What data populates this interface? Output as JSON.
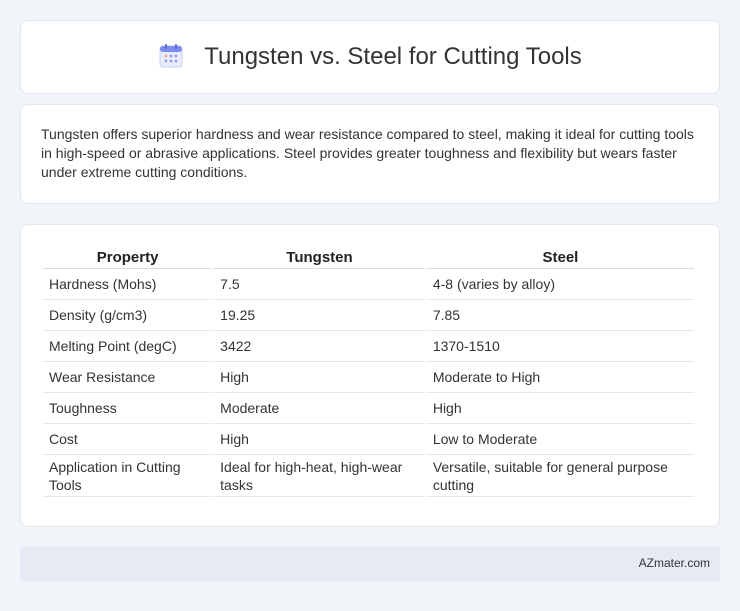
{
  "header": {
    "title": "Tungsten vs. Steel for Cutting Tools",
    "icon": "calendar-icon"
  },
  "summary": {
    "text": "Tungsten offers superior hardness and wear resistance compared to steel, making it ideal for cutting tools in high-speed or abrasive applications. Steel provides greater toughness and flexibility but wears faster under extreme cutting conditions."
  },
  "table": {
    "headers": [
      "Property",
      "Tungsten",
      "Steel"
    ],
    "rows": [
      [
        "Hardness (Mohs)",
        "7.5",
        "4-8 (varies by alloy)"
      ],
      [
        "Density (g/cm3)",
        "19.25",
        "7.85"
      ],
      [
        "Melting Point (degC)",
        "3422",
        "1370-1510"
      ],
      [
        "Wear Resistance",
        "High",
        "Moderate to High"
      ],
      [
        "Toughness",
        "Moderate",
        "High"
      ],
      [
        "Cost",
        "High",
        "Low to Moderate"
      ],
      [
        "Application in Cutting Tools",
        "Ideal for high-heat, high-wear tasks",
        "Versatile, suitable for general purpose cutting"
      ]
    ]
  },
  "footer": {
    "brand": "AZmater.com"
  },
  "colors": {
    "background": "#f1f4f9",
    "card": "#ffffff",
    "footer": "#e5eaf4",
    "icon_accent": "#7c8cf0"
  }
}
